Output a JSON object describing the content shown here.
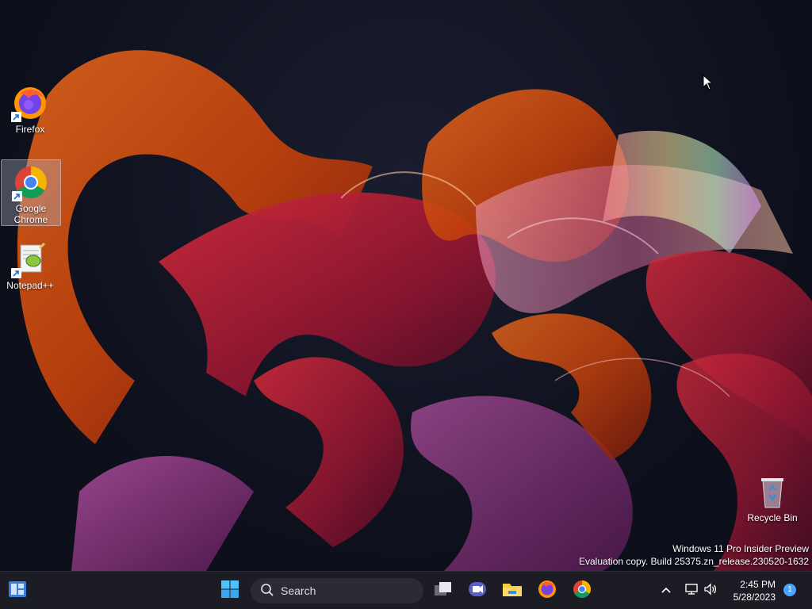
{
  "desktop": {
    "icons": [
      {
        "name": "firefox",
        "label": "Firefox"
      },
      {
        "name": "google-chrome",
        "label": "Google Chrome"
      },
      {
        "name": "notepad-plus-plus",
        "label": "Notepad++"
      },
      {
        "name": "recycle-bin",
        "label": "Recycle Bin"
      }
    ],
    "watermark": {
      "line1": "Windows 11 Pro Insider Preview",
      "line2": "Evaluation copy. Build 25375.zn_release.230520-1632"
    }
  },
  "taskbar": {
    "search_label": "Search",
    "pinned": [
      "widgets-icon",
      "start-icon",
      "task-view-icon",
      "chat-icon",
      "file-explorer-icon",
      "firefox-icon",
      "chrome-icon"
    ],
    "tray": {
      "time": "2:45 PM",
      "date": "5/28/2023",
      "notification_count": "1"
    }
  },
  "colors": {
    "accent": "#4aa3ff",
    "taskbar_bg": "#1c1c24",
    "search_bg": "#2b2b35"
  }
}
